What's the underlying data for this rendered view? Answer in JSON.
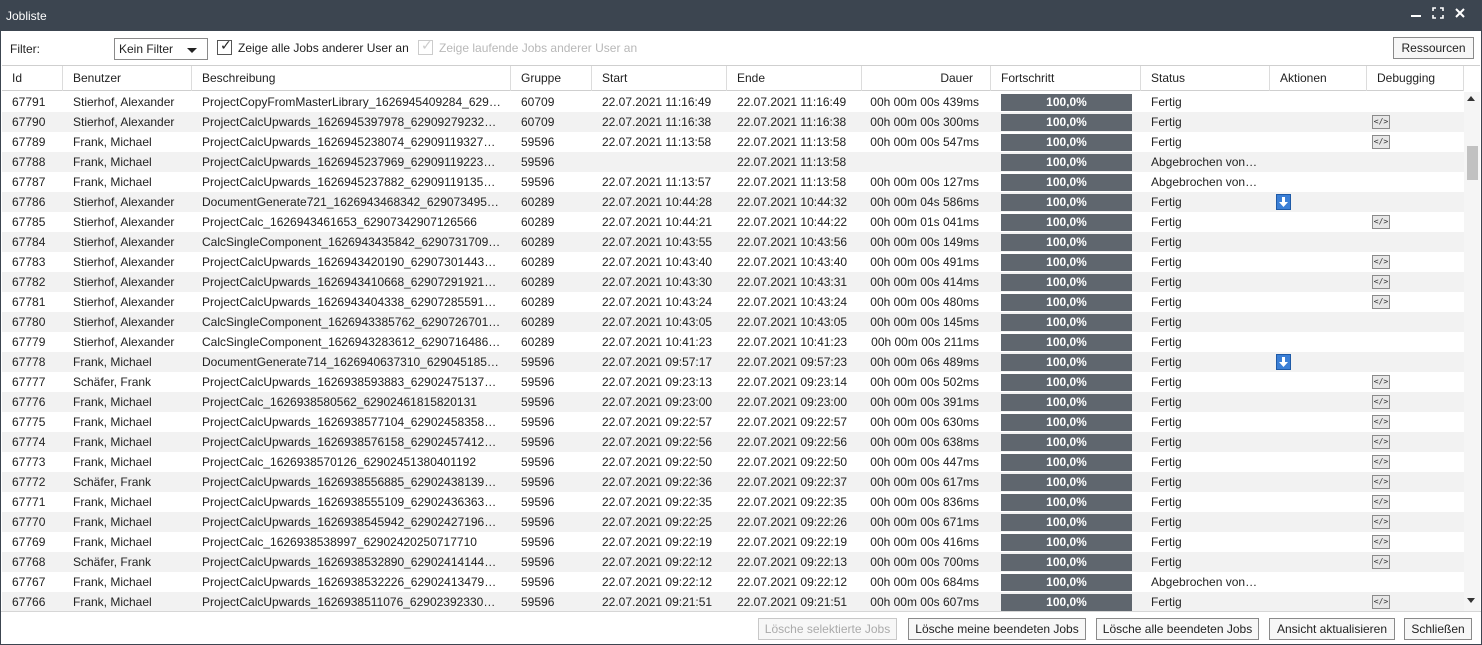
{
  "window": {
    "title": "Jobliste",
    "controls": [
      "minimize-icon",
      "maximize-icon",
      "close-icon"
    ]
  },
  "toolbar": {
    "filter_label": "Filter:",
    "filter_value": "Kein Filter",
    "checkbox_all_users": {
      "label": "Zeige alle Jobs anderer User an",
      "checked": true,
      "enabled": true
    },
    "checkbox_running": {
      "label": "Zeige laufende Jobs anderer User an",
      "checked": true,
      "enabled": false
    },
    "resources_button": "Ressourcen"
  },
  "columns": [
    "Id",
    "Benutzer",
    "Beschreibung",
    "Gruppe",
    "Start",
    "Ende",
    "Dauer",
    "Fortschritt",
    "Status",
    "Aktionen",
    "Debugging"
  ],
  "rows": [
    {
      "id": "67791",
      "user": "Stierhof, Alexander",
      "desc": "ProjectCopyFromMasterLibrary_1626945409284_629…",
      "group": "60709",
      "start": "22.07.2021 11:16:49",
      "end": "22.07.2021 11:16:49",
      "duration": "00h 00m 00s 439ms",
      "progress": "100,0%",
      "status": "Fertig",
      "action": "",
      "debug": ""
    },
    {
      "id": "67790",
      "user": "Stierhof, Alexander",
      "desc": "ProjectCalcUpwards_1626945397978_62909279232…",
      "group": "60709",
      "start": "22.07.2021 11:16:38",
      "end": "22.07.2021 11:16:38",
      "duration": "00h 00m 00s 300ms",
      "progress": "100,0%",
      "status": "Fertig",
      "action": "",
      "debug": "code-icon"
    },
    {
      "id": "67789",
      "user": "Frank, Michael",
      "desc": "ProjectCalcUpwards_1626945238074_62909119327…",
      "group": "59596",
      "start": "22.07.2021 11:13:58",
      "end": "22.07.2021 11:13:58",
      "duration": "00h 00m 00s 547ms",
      "progress": "100,0%",
      "status": "Fertig",
      "action": "",
      "debug": "code-icon"
    },
    {
      "id": "67788",
      "user": "Frank, Michael",
      "desc": "ProjectCalcUpwards_1626945237969_62909119223…",
      "group": "59596",
      "start": "",
      "end": "22.07.2021 11:13:58",
      "duration": "",
      "progress": "100,0%",
      "status": "Abgebrochen von…",
      "action": "",
      "debug": ""
    },
    {
      "id": "67787",
      "user": "Frank, Michael",
      "desc": "ProjectCalcUpwards_1626945237882_62909119135…",
      "group": "59596",
      "start": "22.07.2021 11:13:57",
      "end": "22.07.2021 11:13:58",
      "duration": "00h 00m 00s 127ms",
      "progress": "100,0%",
      "status": "Abgebrochen von…",
      "action": "",
      "debug": ""
    },
    {
      "id": "67786",
      "user": "Stierhof, Alexander",
      "desc": "DocumentGenerate721_1626943468342_629073495…",
      "group": "60289",
      "start": "22.07.2021 10:44:28",
      "end": "22.07.2021 10:44:32",
      "duration": "00h 00m 04s 586ms",
      "progress": "100,0%",
      "status": "Fertig",
      "action": "download-icon",
      "debug": ""
    },
    {
      "id": "67785",
      "user": "Stierhof, Alexander",
      "desc": "ProjectCalc_1626943461653_62907342907126566",
      "group": "60289",
      "start": "22.07.2021 10:44:21",
      "end": "22.07.2021 10:44:22",
      "duration": "00h 00m 01s 041ms",
      "progress": "100,0%",
      "status": "Fertig",
      "action": "",
      "debug": "code-icon"
    },
    {
      "id": "67784",
      "user": "Stierhof, Alexander",
      "desc": "CalcSingleComponent_1626943435842_6290731709…",
      "group": "60289",
      "start": "22.07.2021 10:43:55",
      "end": "22.07.2021 10:43:56",
      "duration": "00h 00m 00s 149ms",
      "progress": "100,0%",
      "status": "Fertig",
      "action": "",
      "debug": ""
    },
    {
      "id": "67783",
      "user": "Stierhof, Alexander",
      "desc": "ProjectCalcUpwards_1626943420190_62907301443…",
      "group": "60289",
      "start": "22.07.2021 10:43:40",
      "end": "22.07.2021 10:43:40",
      "duration": "00h 00m 00s 491ms",
      "progress": "100,0%",
      "status": "Fertig",
      "action": "",
      "debug": "code-icon"
    },
    {
      "id": "67782",
      "user": "Stierhof, Alexander",
      "desc": "ProjectCalcUpwards_1626943410668_62907291921…",
      "group": "60289",
      "start": "22.07.2021 10:43:30",
      "end": "22.07.2021 10:43:31",
      "duration": "00h 00m 00s 414ms",
      "progress": "100,0%",
      "status": "Fertig",
      "action": "",
      "debug": "code-icon"
    },
    {
      "id": "67781",
      "user": "Stierhof, Alexander",
      "desc": "ProjectCalcUpwards_1626943404338_62907285591…",
      "group": "60289",
      "start": "22.07.2021 10:43:24",
      "end": "22.07.2021 10:43:24",
      "duration": "00h 00m 00s 480ms",
      "progress": "100,0%",
      "status": "Fertig",
      "action": "",
      "debug": "code-icon"
    },
    {
      "id": "67780",
      "user": "Stierhof, Alexander",
      "desc": "CalcSingleComponent_1626943385762_6290726701…",
      "group": "60289",
      "start": "22.07.2021 10:43:05",
      "end": "22.07.2021 10:43:05",
      "duration": "00h 00m 00s 145ms",
      "progress": "100,0%",
      "status": "Fertig",
      "action": "",
      "debug": ""
    },
    {
      "id": "67779",
      "user": "Stierhof, Alexander",
      "desc": "CalcSingleComponent_1626943283612_6290716486…",
      "group": "60289",
      "start": "22.07.2021 10:41:23",
      "end": "22.07.2021 10:41:23",
      "duration": "00h 00m 00s 211ms",
      "progress": "100,0%",
      "status": "Fertig",
      "action": "",
      "debug": ""
    },
    {
      "id": "67778",
      "user": "Frank, Michael",
      "desc": "DocumentGenerate714_1626940637310_629045185…",
      "group": "59596",
      "start": "22.07.2021 09:57:17",
      "end": "22.07.2021 09:57:23",
      "duration": "00h 00m 06s 489ms",
      "progress": "100,0%",
      "status": "Fertig",
      "action": "download-icon",
      "debug": ""
    },
    {
      "id": "67777",
      "user": "Schäfer, Frank",
      "desc": "ProjectCalcUpwards_1626938593883_62902475137…",
      "group": "59596",
      "start": "22.07.2021 09:23:13",
      "end": "22.07.2021 09:23:14",
      "duration": "00h 00m 00s 502ms",
      "progress": "100,0%",
      "status": "Fertig",
      "action": "",
      "debug": "code-icon"
    },
    {
      "id": "67776",
      "user": "Frank, Michael",
      "desc": "ProjectCalc_1626938580562_62902461815820131",
      "group": "59596",
      "start": "22.07.2021 09:23:00",
      "end": "22.07.2021 09:23:00",
      "duration": "00h 00m 00s 391ms",
      "progress": "100,0%",
      "status": "Fertig",
      "action": "",
      "debug": "code-icon"
    },
    {
      "id": "67775",
      "user": "Frank, Michael",
      "desc": "ProjectCalcUpwards_1626938577104_62902458358…",
      "group": "59596",
      "start": "22.07.2021 09:22:57",
      "end": "22.07.2021 09:22:57",
      "duration": "00h 00m 00s 630ms",
      "progress": "100,0%",
      "status": "Fertig",
      "action": "",
      "debug": "code-icon"
    },
    {
      "id": "67774",
      "user": "Frank, Michael",
      "desc": "ProjectCalcUpwards_1626938576158_62902457412…",
      "group": "59596",
      "start": "22.07.2021 09:22:56",
      "end": "22.07.2021 09:22:56",
      "duration": "00h 00m 00s 638ms",
      "progress": "100,0%",
      "status": "Fertig",
      "action": "",
      "debug": "code-icon"
    },
    {
      "id": "67773",
      "user": "Frank, Michael",
      "desc": "ProjectCalc_1626938570126_62902451380401192",
      "group": "59596",
      "start": "22.07.2021 09:22:50",
      "end": "22.07.2021 09:22:50",
      "duration": "00h 00m 00s 447ms",
      "progress": "100,0%",
      "status": "Fertig",
      "action": "",
      "debug": "code-icon"
    },
    {
      "id": "67772",
      "user": "Schäfer, Frank",
      "desc": "ProjectCalcUpwards_1626938556885_62902438139…",
      "group": "59596",
      "start": "22.07.2021 09:22:36",
      "end": "22.07.2021 09:22:37",
      "duration": "00h 00m 00s 617ms",
      "progress": "100,0%",
      "status": "Fertig",
      "action": "",
      "debug": "code-icon"
    },
    {
      "id": "67771",
      "user": "Frank, Michael",
      "desc": "ProjectCalcUpwards_1626938555109_62902436363…",
      "group": "59596",
      "start": "22.07.2021 09:22:35",
      "end": "22.07.2021 09:22:35",
      "duration": "00h 00m 00s 836ms",
      "progress": "100,0%",
      "status": "Fertig",
      "action": "",
      "debug": "code-icon"
    },
    {
      "id": "67770",
      "user": "Frank, Michael",
      "desc": "ProjectCalcUpwards_1626938545942_62902427196…",
      "group": "59596",
      "start": "22.07.2021 09:22:25",
      "end": "22.07.2021 09:22:26",
      "duration": "00h 00m 00s 671ms",
      "progress": "100,0%",
      "status": "Fertig",
      "action": "",
      "debug": "code-icon"
    },
    {
      "id": "67769",
      "user": "Frank, Michael",
      "desc": "ProjectCalc_1626938538997_62902420250717710",
      "group": "59596",
      "start": "22.07.2021 09:22:19",
      "end": "22.07.2021 09:22:19",
      "duration": "00h 00m 00s 416ms",
      "progress": "100,0%",
      "status": "Fertig",
      "action": "",
      "debug": "code-icon"
    },
    {
      "id": "67768",
      "user": "Schäfer, Frank",
      "desc": "ProjectCalcUpwards_1626938532890_62902414144…",
      "group": "59596",
      "start": "22.07.2021 09:22:12",
      "end": "22.07.2021 09:22:13",
      "duration": "00h 00m 00s 700ms",
      "progress": "100,0%",
      "status": "Fertig",
      "action": "",
      "debug": "code-icon"
    },
    {
      "id": "67767",
      "user": "Frank, Michael",
      "desc": "ProjectCalcUpwards_1626938532226_62902413479…",
      "group": "59596",
      "start": "22.07.2021 09:22:12",
      "end": "22.07.2021 09:22:12",
      "duration": "00h 00m 00s 684ms",
      "progress": "100,0%",
      "status": "Abgebrochen von…",
      "action": "",
      "debug": ""
    },
    {
      "id": "67766",
      "user": "Frank, Michael",
      "desc": "ProjectCalcUpwards_1626938511076_62902392330…",
      "group": "59596",
      "start": "22.07.2021 09:21:51",
      "end": "22.07.2021 09:21:51",
      "duration": "00h 00m 00s 607ms",
      "progress": "100,0%",
      "status": "Fertig",
      "action": "",
      "debug": "code-icon"
    }
  ],
  "footer": {
    "delete_selected": "Lösche selektierte Jobs",
    "delete_mine": "Lösche meine beendeten Jobs",
    "delete_all": "Lösche alle beendeten Jobs",
    "refresh": "Ansicht aktualisieren",
    "close": "Schließen"
  },
  "colors": {
    "titlebar": "#3c4550",
    "progress_bar": "#5f666e",
    "row_alt": "#f2f2f2"
  }
}
